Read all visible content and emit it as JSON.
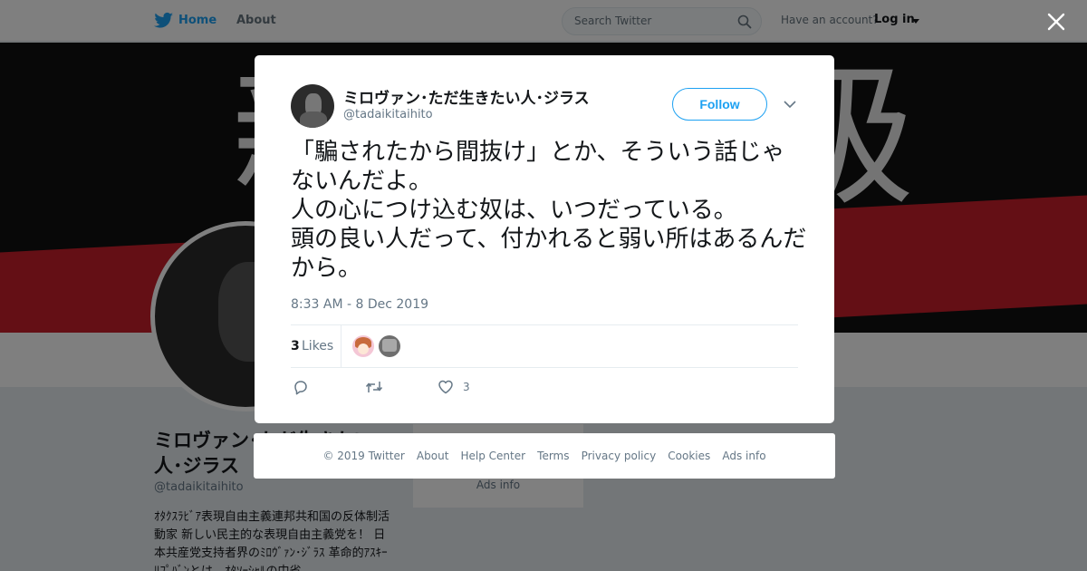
{
  "topbar": {
    "home": "Home",
    "about": "About",
    "search_placeholder": "Search Twitter",
    "have_account": "Have an account?",
    "login": "Log in"
  },
  "profile": {
    "name": "ミロヴァン･ただ生きたい人･ジラス",
    "handle": "@tadaikitaihito",
    "bio": "ｵﾀｸｽﾗﾋﾞｱ表現自由主義連邦共和国の反体制活動家 新しい民主的な表現自由主義党を！ 日本共産党支持者界のﾐﾛｳﾞｧﾝ･ｼﾞﾗｽ 革命的ｱｽｷｰﾘﾌﾟﾊﾞﾝとは、ｵﾀｿｰｼｬﾙの中省"
  },
  "side_card": {
    "copyright": "© 2019 Twitter",
    "ads": "Ads info"
  },
  "tweet": {
    "author_name": "ミロヴァン･ただ生きたい人･ジラス",
    "author_handle": "@tadaikitaihito",
    "follow_label": "Follow",
    "text": "「騙されたから間抜け」とか、そういう話じゃないんだよ。\n人の心につけ込む奴は、いつだっている。\n頭の良い人だって、付かれると弱い所はあるんだから。",
    "timestamp": "8:33 AM - 8 Dec 2019",
    "likes_count": "3",
    "likes_label": "Likes",
    "action_like_count": "3"
  },
  "footer": {
    "copyright": "© 2019 Twitter",
    "about": "About",
    "help": "Help Center",
    "terms": "Terms",
    "privacy": "Privacy policy",
    "cookies": "Cookies",
    "ads": "Ads info"
  },
  "colors": {
    "accent": "#1da1f2",
    "text_primary": "#14171a",
    "text_secondary": "#657786",
    "banner_red": "#c81e2a"
  },
  "icons": [
    "twitter-bird-icon",
    "search-icon",
    "close-icon",
    "chevron-down-icon",
    "reply-icon",
    "retweet-icon",
    "heart-icon"
  ]
}
